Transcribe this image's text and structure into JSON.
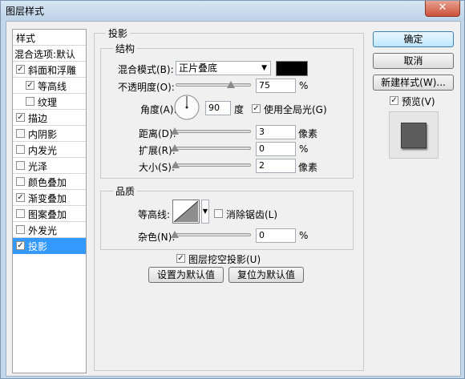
{
  "window": {
    "title": "图层样式",
    "close_label": "✕"
  },
  "left_panel": {
    "header": "样式",
    "blend_options": "混合选项:默认",
    "items": [
      {
        "label": "斜面和浮雕",
        "checked": true
      },
      {
        "label": "等高线",
        "checked": true
      },
      {
        "label": "纹理",
        "checked": false
      },
      {
        "label": "描边",
        "checked": true
      },
      {
        "label": "内阴影",
        "checked": false
      },
      {
        "label": "内发光",
        "checked": false
      },
      {
        "label": "光泽",
        "checked": false
      },
      {
        "label": "颜色叠加",
        "checked": false
      },
      {
        "label": "渐变叠加",
        "checked": true
      },
      {
        "label": "图案叠加",
        "checked": false
      },
      {
        "label": "外发光",
        "checked": false
      },
      {
        "label": "投影",
        "checked": true,
        "selected": true
      }
    ]
  },
  "drop_shadow": {
    "title": "投影",
    "structure": {
      "title": "结构",
      "blend_mode_label": "混合模式(B):",
      "blend_mode_value": "正片叠底",
      "shadow_color": "#000000",
      "opacity_label": "不透明度(O):",
      "opacity_value": "75",
      "opacity_unit": "%",
      "opacity_level": 75,
      "angle_label": "角度(A):",
      "angle_value": "90",
      "angle_unit": "度",
      "global_light_label": "使用全局光(G)",
      "global_light_checked": true,
      "distance_label": "距离(D):",
      "distance_value": "3",
      "distance_unit": "像素",
      "spread_label": "扩展(R):",
      "spread_value": "0",
      "spread_unit": "%",
      "size_label": "大小(S):",
      "size_value": "2",
      "size_unit": "像素"
    },
    "quality": {
      "title": "品质",
      "contour_label": "等高线:",
      "anti_alias_label": "消除锯齿(L)",
      "anti_alias_checked": false,
      "noise_label": "杂色(N):",
      "noise_value": "0",
      "noise_unit": "%"
    },
    "knockout_label": "图层挖空投影(U)",
    "knockout_checked": true,
    "make_default_label": "设置为默认值",
    "reset_default_label": "复位为默认值"
  },
  "buttons": {
    "ok_label": "确定",
    "cancel_label": "取消",
    "new_style_label": "新建样式(W)...",
    "preview_label": "预览(V)",
    "preview_checked": true
  }
}
